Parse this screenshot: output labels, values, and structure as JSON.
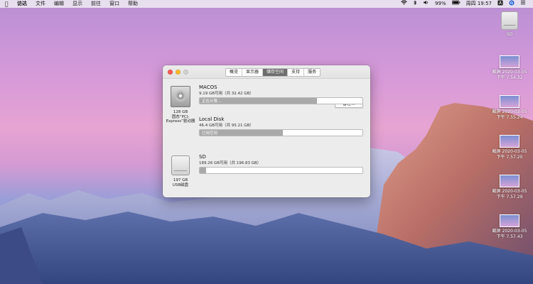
{
  "menubar": {
    "app_name": "访达",
    "items": [
      "文件",
      "编辑",
      "显示",
      "前往",
      "窗口",
      "帮助"
    ],
    "battery": "99%",
    "datetime": "周四 19:57"
  },
  "desktop": {
    "sd_label": "SD",
    "screenshots": [
      {
        "name": "截屏 2020-03-05",
        "time": "下午 7.54.32"
      },
      {
        "name": "截屏 2020-03-05",
        "time": "下午 7.55.24"
      },
      {
        "name": "截屏 2020-03-05",
        "time": "下午 7.57.20"
      },
      {
        "name": "截屏 2020-03-05",
        "time": "下午 7.57.29"
      },
      {
        "name": "截屏 2020-03-05",
        "time": "下午 7.57.43"
      }
    ]
  },
  "window": {
    "tabs": [
      "概览",
      "显示器",
      "储存空间",
      "支持",
      "服务"
    ],
    "active_tab": 2,
    "internal_disk": {
      "size": "128 GB",
      "type_line1": "固态“PCI-",
      "type_line2": "Express”驱动器"
    },
    "usb_disk": {
      "size": "197 GB",
      "type": "USB磁盘"
    },
    "manage_label": "管理…",
    "volumes": [
      {
        "name": "MACOS",
        "info": "9.19 GB可用（共 32.42 GB）",
        "bar_text": "正在计算…",
        "used_fraction": 0.72
      },
      {
        "name": "Local Disk",
        "info": "46.4 GB可用（共 95.21 GB）",
        "bar_text": "已用空间",
        "used_fraction": 0.51
      },
      {
        "name": "SD",
        "info": "189.26 GB可用（共 196.83 GB）",
        "bar_text": "",
        "used_fraction": 0.04
      }
    ]
  }
}
